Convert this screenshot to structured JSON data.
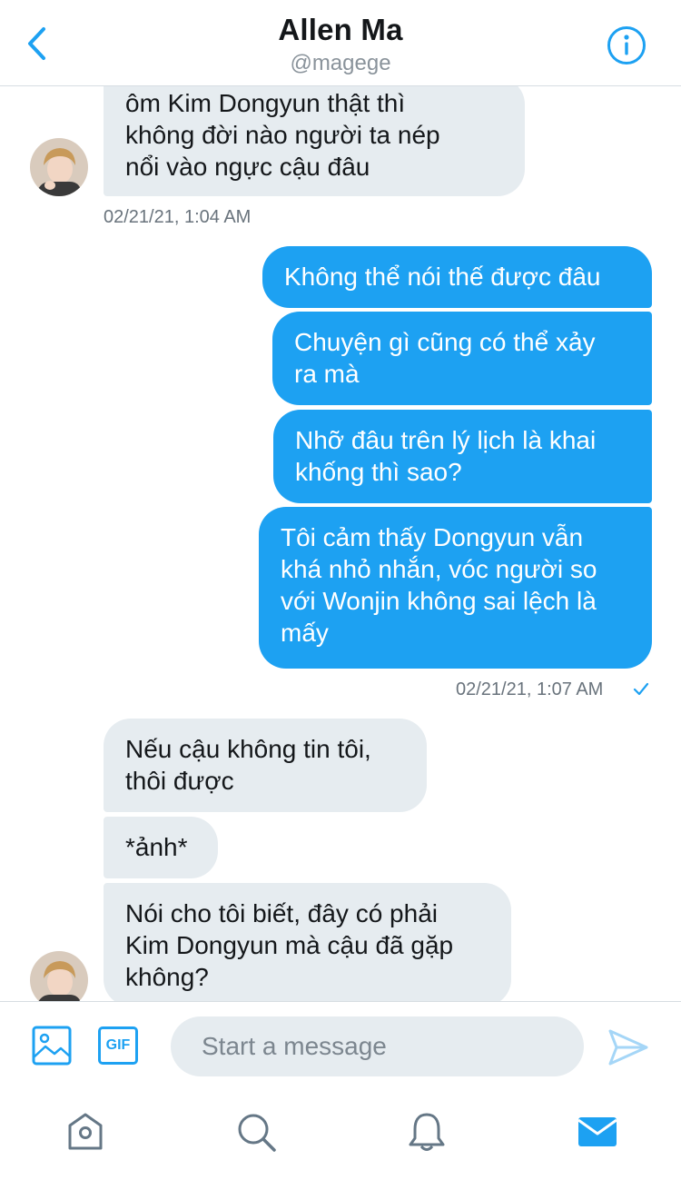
{
  "header": {
    "name": "Allen Ma",
    "handle": "@magege"
  },
  "messages": {
    "m1": "ôm Kim Dongyun thật thì\nkhông đời nào người ta nép\nnổi vào ngực cậu đâu",
    "ts1": "02/21/21, 1:04 AM",
    "m2": "Không thể nói thế được đâu",
    "m3": "Chuyện gì cũng có thể xảy\nra mà",
    "m4": "Nhỡ đâu trên lý lịch là khai\nkhống thì sao?",
    "m5": "Tôi cảm thấy Dongyun vẫn\nkhá nhỏ nhắn, vóc người so\nvới Wonjin không sai lệch là\nmấy",
    "ts2": "02/21/21, 1:07 AM",
    "m6": "Nếu cậu không tin tôi,\nthôi được",
    "m7": "*ảnh*",
    "m8": "Nói cho tôi biết, đây có phải\nKim Dongyun mà cậu đã gặp\nkhông?"
  },
  "composer": {
    "gif_label": "GIF",
    "placeholder": "Start a message"
  },
  "icons": {
    "back": "chevron-left-icon",
    "info": "info-icon",
    "image": "image-icon",
    "send": "send-icon",
    "home": "home-icon",
    "search": "search-icon",
    "notifications": "bell-icon",
    "messages": "envelope-icon",
    "read_receipt": "checkmark-icon"
  },
  "colors": {
    "accent": "#1da1f2",
    "incoming_bubble": "#e6ecf0",
    "outgoing_bubble": "#1da1f2",
    "muted_text": "#69737c",
    "inactive_icon": "#657786"
  }
}
